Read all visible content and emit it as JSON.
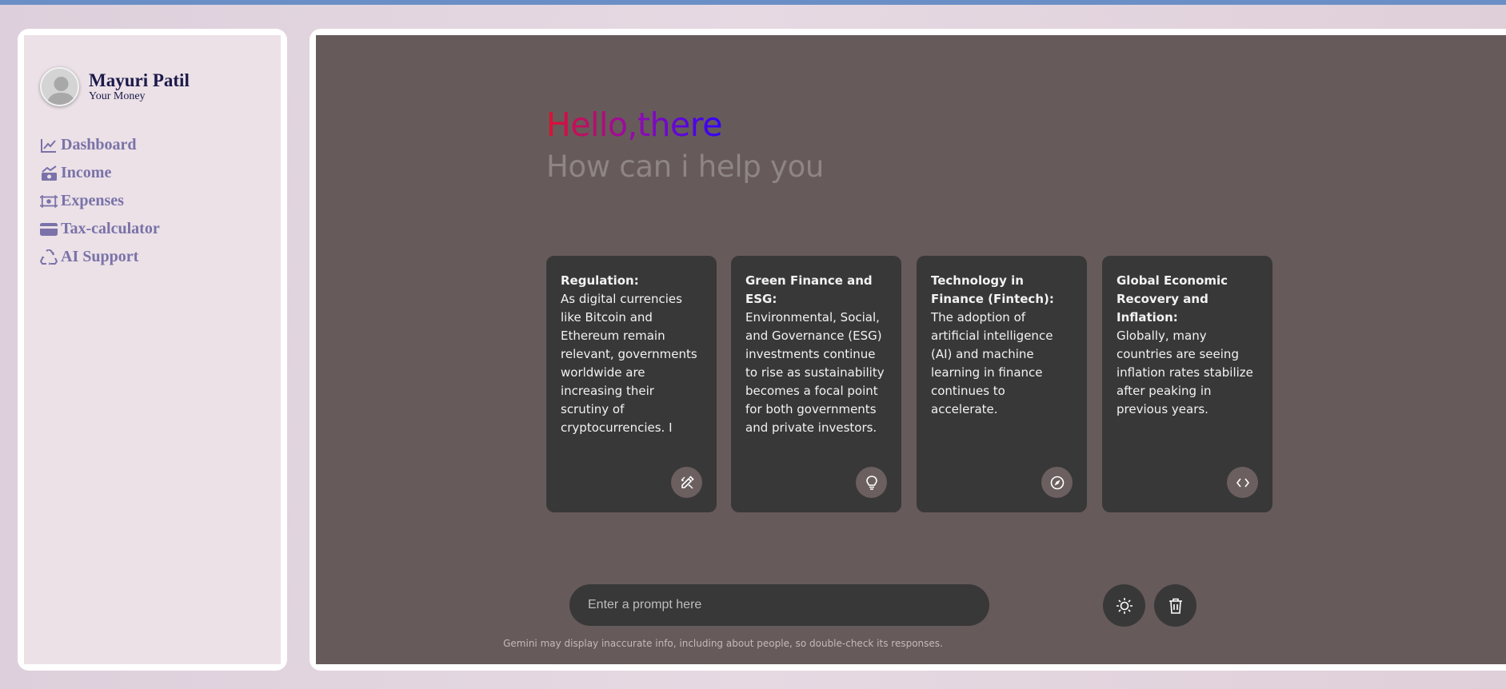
{
  "profile": {
    "name": "Mayuri Patil",
    "subtitle": "Your Money"
  },
  "nav": {
    "items": [
      {
        "label": "Dashboard",
        "icon": "chart-line-icon"
      },
      {
        "label": "Income",
        "icon": "money-bill-trend-icon"
      },
      {
        "label": "Expenses",
        "icon": "money-bill-transfer-icon"
      },
      {
        "label": "Tax-calculator",
        "icon": "credit-card-icon"
      },
      {
        "label": "AI Support",
        "icon": "recycle-icon"
      }
    ]
  },
  "greeting": {
    "title": "Hello,there",
    "subtitle": "How can i help you"
  },
  "cards": [
    {
      "title": "Regulation:",
      "body": "As digital currencies like Bitcoin and Ethereum remain relevant, governments worldwide are increasing their scrutiny of cryptocurrencies. I",
      "icon": "pencil-ruler-icon"
    },
    {
      "title": "Green Finance and ESG:",
      "body": "Environmental, Social, and Governance (ESG) investments continue to rise as sustainability becomes a focal point for both governments and private investors.",
      "icon": "lightbulb-icon"
    },
    {
      "title": "Technology in Finance (Fintech):",
      "body": "The adoption of artificial intelligence (AI) and machine learning in finance continues to accelerate.",
      "icon": "compass-icon"
    },
    {
      "title": "Global Economic Recovery and Inflation:",
      "body": "Globally, many countries are seeing inflation rates stabilize after peaking in previous years.",
      "icon": "code-icon"
    }
  ],
  "prompt": {
    "placeholder": "Enter a prompt here"
  },
  "actions": {
    "theme_icon": "sun-icon",
    "delete_icon": "trash-icon"
  },
  "disclaimer": "Gemini may display inaccurate info, including about people, so double-check its responses.",
  "colors": {
    "sidebar_text": "#7a72a8",
    "main_background": "#675a5a",
    "card_background": "#383838",
    "greeting_gradient_start": "#e0102e",
    "greeting_gradient_end": "#2f00ff"
  }
}
